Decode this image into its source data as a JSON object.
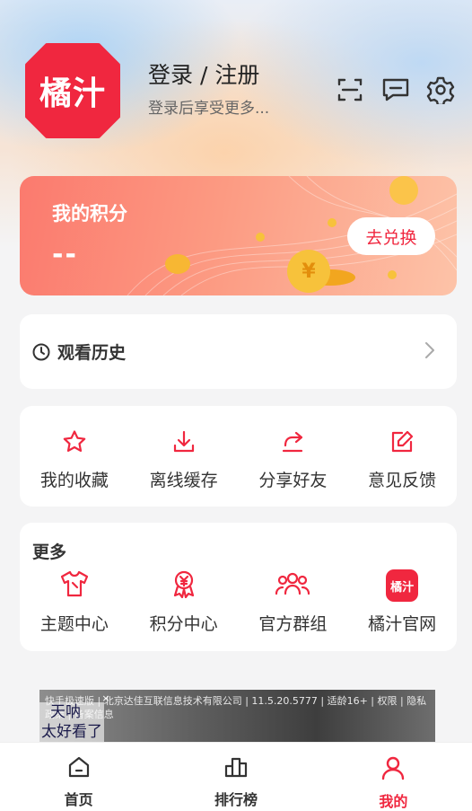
{
  "profile": {
    "logo_text": "橘汁",
    "login_title": "登录 / 注册",
    "login_subtitle": "登录后享受更多..."
  },
  "top_icons": [
    "scan-icon",
    "message-icon",
    "settings-icon"
  ],
  "points_card": {
    "title": "我的积分",
    "value": "--",
    "exchange_label": "去兑换"
  },
  "history": {
    "label": "观看历史"
  },
  "shortcuts": [
    {
      "label": "我的收藏",
      "icon": "star-icon"
    },
    {
      "label": "离线缓存",
      "icon": "download-icon"
    },
    {
      "label": "分享好友",
      "icon": "share-icon"
    },
    {
      "label": "意见反馈",
      "icon": "feedback-edit-icon"
    }
  ],
  "more": {
    "title": "更多",
    "items": [
      {
        "label": "主题中心",
        "icon": "tshirt-icon"
      },
      {
        "label": "积分中心",
        "icon": "yuan-medal-icon"
      },
      {
        "label": "官方群组",
        "icon": "group-icon"
      },
      {
        "label": "橘汁官网",
        "icon": "juzhi-logo-icon",
        "icon_text": "橘汁"
      }
    ]
  },
  "ad": {
    "meta": "快手极速版 | 北京达佳互联信息技术有限公司 | 11.5.20.5777 | 适龄16+ | 权限 | 隐私政策 | 备案信息",
    "overlay_line1": "天呐",
    "overlay_line2": "太好看了",
    "close": "×"
  },
  "tabbar": [
    {
      "label": "首页",
      "icon": "home-icon",
      "active": false
    },
    {
      "label": "排行榜",
      "icon": "ranking-icon",
      "active": false
    },
    {
      "label": "我的",
      "icon": "user-icon",
      "active": true
    }
  ],
  "colors": {
    "accent": "#f0273f",
    "text": "#333333"
  }
}
